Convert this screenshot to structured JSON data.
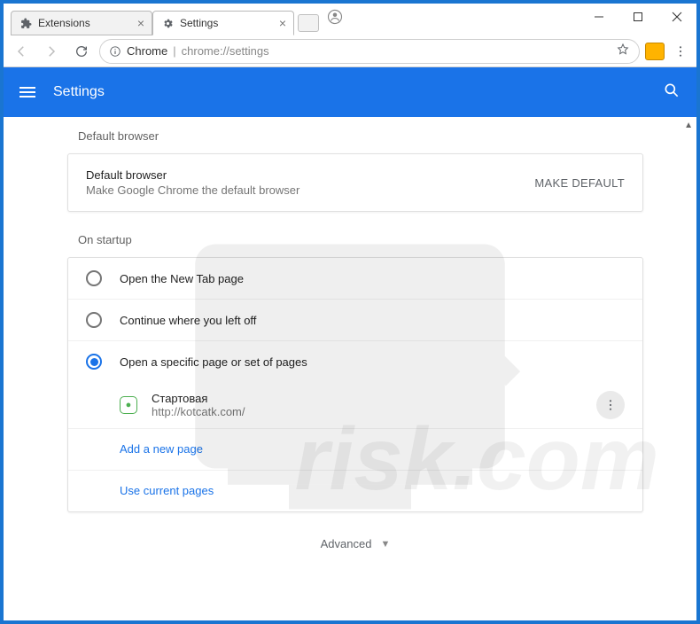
{
  "tabs": [
    {
      "label": "Extensions"
    },
    {
      "label": "Settings"
    }
  ],
  "url": {
    "origin": "Chrome",
    "path": "chrome://settings"
  },
  "header": {
    "title": "Settings"
  },
  "defaultBrowser": {
    "sectionLabel": "Default browser",
    "title": "Default browser",
    "subtitle": "Make Google Chrome the default browser",
    "button": "MAKE DEFAULT"
  },
  "startup": {
    "sectionLabel": "On startup",
    "options": [
      {
        "label": "Open the New Tab page",
        "checked": false
      },
      {
        "label": "Continue where you left off",
        "checked": false
      },
      {
        "label": "Open a specific page or set of pages",
        "checked": true
      }
    ],
    "page": {
      "title": "Стартовая",
      "url": "http://kotcatk.com/"
    },
    "addPage": "Add a new page",
    "useCurrent": "Use current pages"
  },
  "advanced": "Advanced"
}
